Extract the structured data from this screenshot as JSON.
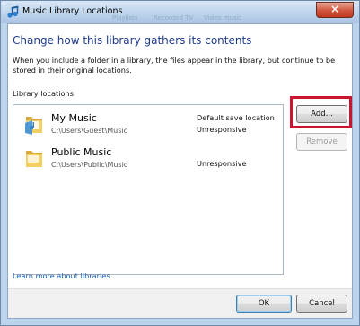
{
  "window": {
    "title": "Music Library Locations",
    "close_glyph": "×",
    "ghost_labels": [
      "Playlists",
      "Recorded TV",
      "Video music"
    ]
  },
  "content": {
    "heading": "Change how this library gathers its contents",
    "description": "When you include a folder in a library, the files appear in the library, but continue to be stored in their original locations.",
    "locations_label": "Library locations",
    "learn_more": "Learn more about libraries"
  },
  "locations": [
    {
      "name": "My Music",
      "path": "C:\\Users\\Guest\\Music",
      "status_line1": "Default save location",
      "status_line2": "Unresponsive",
      "icon": "music-folder-icon"
    },
    {
      "name": "Public Music",
      "path": "C:\\Users\\Public\\Music",
      "status_line1": "",
      "status_line2": "Unresponsive",
      "icon": "folder-icon"
    }
  ],
  "buttons": {
    "add": "Add...",
    "remove": "Remove",
    "ok": "OK",
    "cancel": "Cancel"
  },
  "colors": {
    "heading": "#1e3c8c",
    "link": "#1a5fb4",
    "highlight": "#c9152f"
  }
}
